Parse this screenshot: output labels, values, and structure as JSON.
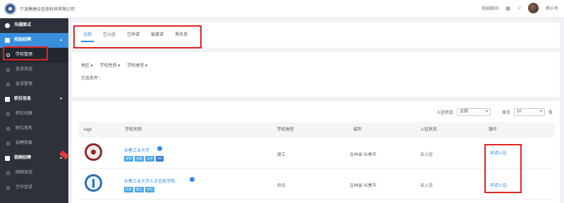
{
  "header": {
    "company": "宁波唐唐云信息科技有限公司",
    "campus_recruit_link": "校招顾问",
    "user_name": "杨小冬"
  },
  "sidebar": {
    "items": [
      {
        "label": "沟通面试",
        "type": "group"
      },
      {
        "label": "校园招聘",
        "type": "group-active"
      },
      {
        "label": "学校管理",
        "type": "sub-selected"
      },
      {
        "label": "宣讲双选",
        "type": "sub"
      },
      {
        "label": "宣讲管理",
        "type": "sub"
      },
      {
        "label": "职位信息",
        "type": "group"
      },
      {
        "label": "职位创建",
        "type": "sub"
      },
      {
        "label": "职位发布",
        "type": "sub"
      },
      {
        "label": "招聘简章",
        "type": "sub"
      },
      {
        "label": "视频招聘",
        "type": "group"
      },
      {
        "label": "网络双选",
        "type": "sub"
      },
      {
        "label": "空中宣讲",
        "type": "sub"
      }
    ]
  },
  "tabs": [
    "全部",
    "已入驻",
    "已申请",
    "被邀请",
    "黑名单"
  ],
  "active_tab": 0,
  "filters": [
    "地区 ▾",
    "学校性质 ▾",
    "学校类型 ▾"
  ],
  "selected_conditions_label": "已选条件：",
  "controls": {
    "status_label": "入驻状态",
    "status_value": "全部",
    "display_label": "显示",
    "display_value": "10",
    "unit": "条"
  },
  "table": {
    "columns": [
      "logo",
      "学校名称",
      "学校类型",
      "城市",
      "入驻状态",
      "操作"
    ],
    "rows": [
      {
        "name": "长春工业大学",
        "tags": [
          "本科",
          "省属",
          "公办",
          "VIP"
        ],
        "type": "理工",
        "city": "吉林省-长春市",
        "status": "未入驻",
        "action": "申请入驻"
      },
      {
        "name": "长春工业大学人文信息学院",
        "tags": [
          "民办",
          "独立",
          "本科"
        ],
        "type": "综合",
        "city": "吉林省-长春市",
        "status": "未入驻",
        "action": "申请入驻"
      }
    ]
  },
  "colors": {
    "accent": "#2d8cf0",
    "sidebar_bg": "#2d3139",
    "highlight": "#e02323"
  }
}
